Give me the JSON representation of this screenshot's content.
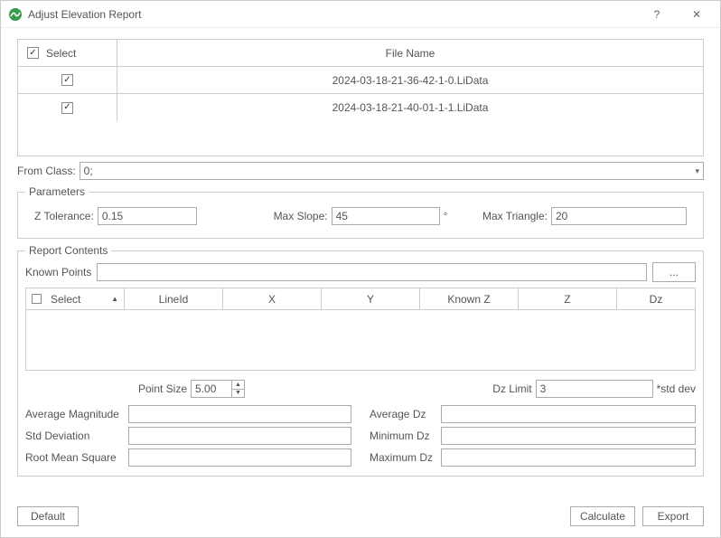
{
  "window": {
    "title": "Adjust Elevation Report",
    "help_glyph": "?",
    "close_glyph": "✕"
  },
  "fileTable": {
    "header_select": "Select",
    "header_filename": "File Name",
    "rows": [
      {
        "checked": true,
        "name": "2024-03-18-21-36-42-1-0.LiData"
      },
      {
        "checked": true,
        "name": "2024-03-18-21-40-01-1-1.LiData"
      }
    ]
  },
  "fromClass": {
    "label": "From Class:",
    "value": "0;"
  },
  "parameters": {
    "legend": "Parameters",
    "zTolerance": {
      "label": "Z Tolerance:",
      "value": "0.15"
    },
    "maxSlope": {
      "label": "Max Slope:",
      "value": "45",
      "unit": "°"
    },
    "maxTriangle": {
      "label": "Max Triangle:",
      "value": "20"
    }
  },
  "report": {
    "legend": "Report Contents",
    "knownPoints": {
      "label": "Known Points",
      "value": "",
      "browse": "..."
    },
    "grid": {
      "columns": [
        "Select",
        "LineId",
        "X",
        "Y",
        "Known Z",
        "Z",
        "Dz"
      ]
    },
    "pointSize": {
      "label": "Point Size",
      "value": "5.00"
    },
    "dzLimit": {
      "label": "Dz Limit",
      "value": "3",
      "suffix": "*std dev"
    },
    "stats": {
      "avgMag": {
        "label": "Average Magnitude",
        "value": ""
      },
      "stdDev": {
        "label": "Std Deviation",
        "value": ""
      },
      "rms": {
        "label": "Root Mean Square",
        "value": ""
      },
      "avgDz": {
        "label": "Average Dz",
        "value": ""
      },
      "minDz": {
        "label": "Minimum Dz",
        "value": ""
      },
      "maxDz": {
        "label": "Maximum Dz",
        "value": ""
      }
    }
  },
  "footer": {
    "default": "Default",
    "calculate": "Calculate",
    "export": "Export"
  }
}
